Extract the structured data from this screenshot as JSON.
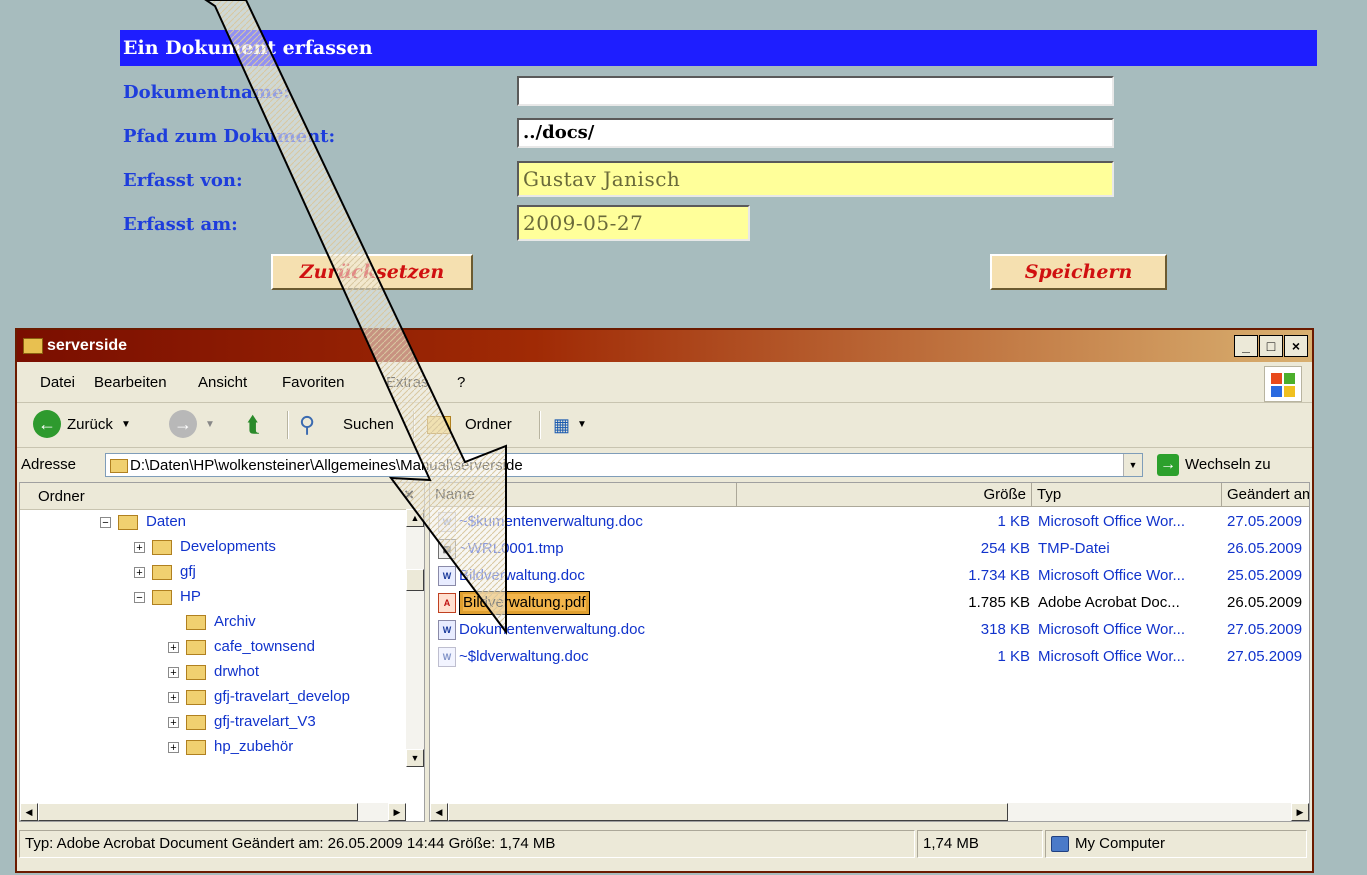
{
  "form": {
    "title": "Ein Dokument erfassen",
    "fields": [
      {
        "label": "Dokumentname:",
        "value": ""
      },
      {
        "label": "Pfad zum Dokument:",
        "value": "../docs/"
      },
      {
        "label": "Erfasst von:",
        "value": "Gustav Janisch"
      },
      {
        "label": "Erfasst am:",
        "value": "2009-05-27"
      }
    ],
    "reset_label": "Zurücksetzen",
    "save_label": "Speichern"
  },
  "window": {
    "title": "serverside",
    "controls": {
      "minimize": "_",
      "maximize": "□",
      "close": "×"
    },
    "menu": [
      "Datei",
      "Bearbeiten",
      "Ansicht",
      "Favoriten",
      "Extras",
      "?"
    ],
    "toolbar": {
      "back": "Zurück",
      "search": "Suchen",
      "folders": "Ordner"
    },
    "address": {
      "label": "Adresse",
      "path": "D:\\Daten\\HP\\wolkensteiner\\Allgemeines\\Manual\\serverside",
      "go_label": "Wechseln zu"
    },
    "folder_pane": {
      "title": "Ordner",
      "close": "×",
      "items": [
        {
          "label": "Daten",
          "expander": "−"
        },
        {
          "label": "Developments",
          "expander": "+"
        },
        {
          "label": "gfj",
          "expander": "+"
        },
        {
          "label": "HP",
          "expander": "−"
        },
        {
          "label": "Archiv",
          "expander": ""
        },
        {
          "label": "cafe_townsend",
          "expander": "+"
        },
        {
          "label": "drwhot",
          "expander": "+"
        },
        {
          "label": "gfj-travelart_develop",
          "expander": "+"
        },
        {
          "label": "gfj-travelart_V3",
          "expander": "+"
        },
        {
          "label": "hp_zubehör",
          "expander": "+"
        }
      ]
    },
    "file_list": {
      "columns": [
        "Name",
        "Größe",
        "Typ",
        "Geändert am"
      ],
      "rows": [
        {
          "name": "~$kumentenverwaltung.doc",
          "size": "1 KB",
          "type": "Microsoft Office Wor...",
          "modified": "27.05.2009"
        },
        {
          "name": "~WRL0001.tmp",
          "size": "254 KB",
          "type": "TMP-Datei",
          "modified": "26.05.2009"
        },
        {
          "name": "Bildverwaltung.doc",
          "size": "1.734 KB",
          "type": "Microsoft Office Wor...",
          "modified": "25.05.2009"
        },
        {
          "name": "Bildverwaltung.pdf",
          "size": "1.785 KB",
          "type": "Adobe Acrobat Doc...",
          "modified": "26.05.2009"
        },
        {
          "name": "Dokumentenverwaltung.doc",
          "size": "318 KB",
          "type": "Microsoft Office Wor...",
          "modified": "27.05.2009"
        },
        {
          "name": "~$ldverwaltung.doc",
          "size": "1 KB",
          "type": "Microsoft Office Wor...",
          "modified": "27.05.2009"
        }
      ]
    },
    "status": {
      "info": "Typ: Adobe Acrobat Document Geändert am: 26.05.2009 14:44 Größe: 1,74 MB",
      "size": "1,74 MB",
      "zone": "My Computer"
    }
  },
  "colors": {
    "page_bg": "#a7bcbe",
    "header_bg": "#1e1eff",
    "label_color": "#1e3ddc",
    "readonly_bg": "#ffff9a",
    "button_text": "#d01010",
    "link_blue": "#1133cc"
  }
}
